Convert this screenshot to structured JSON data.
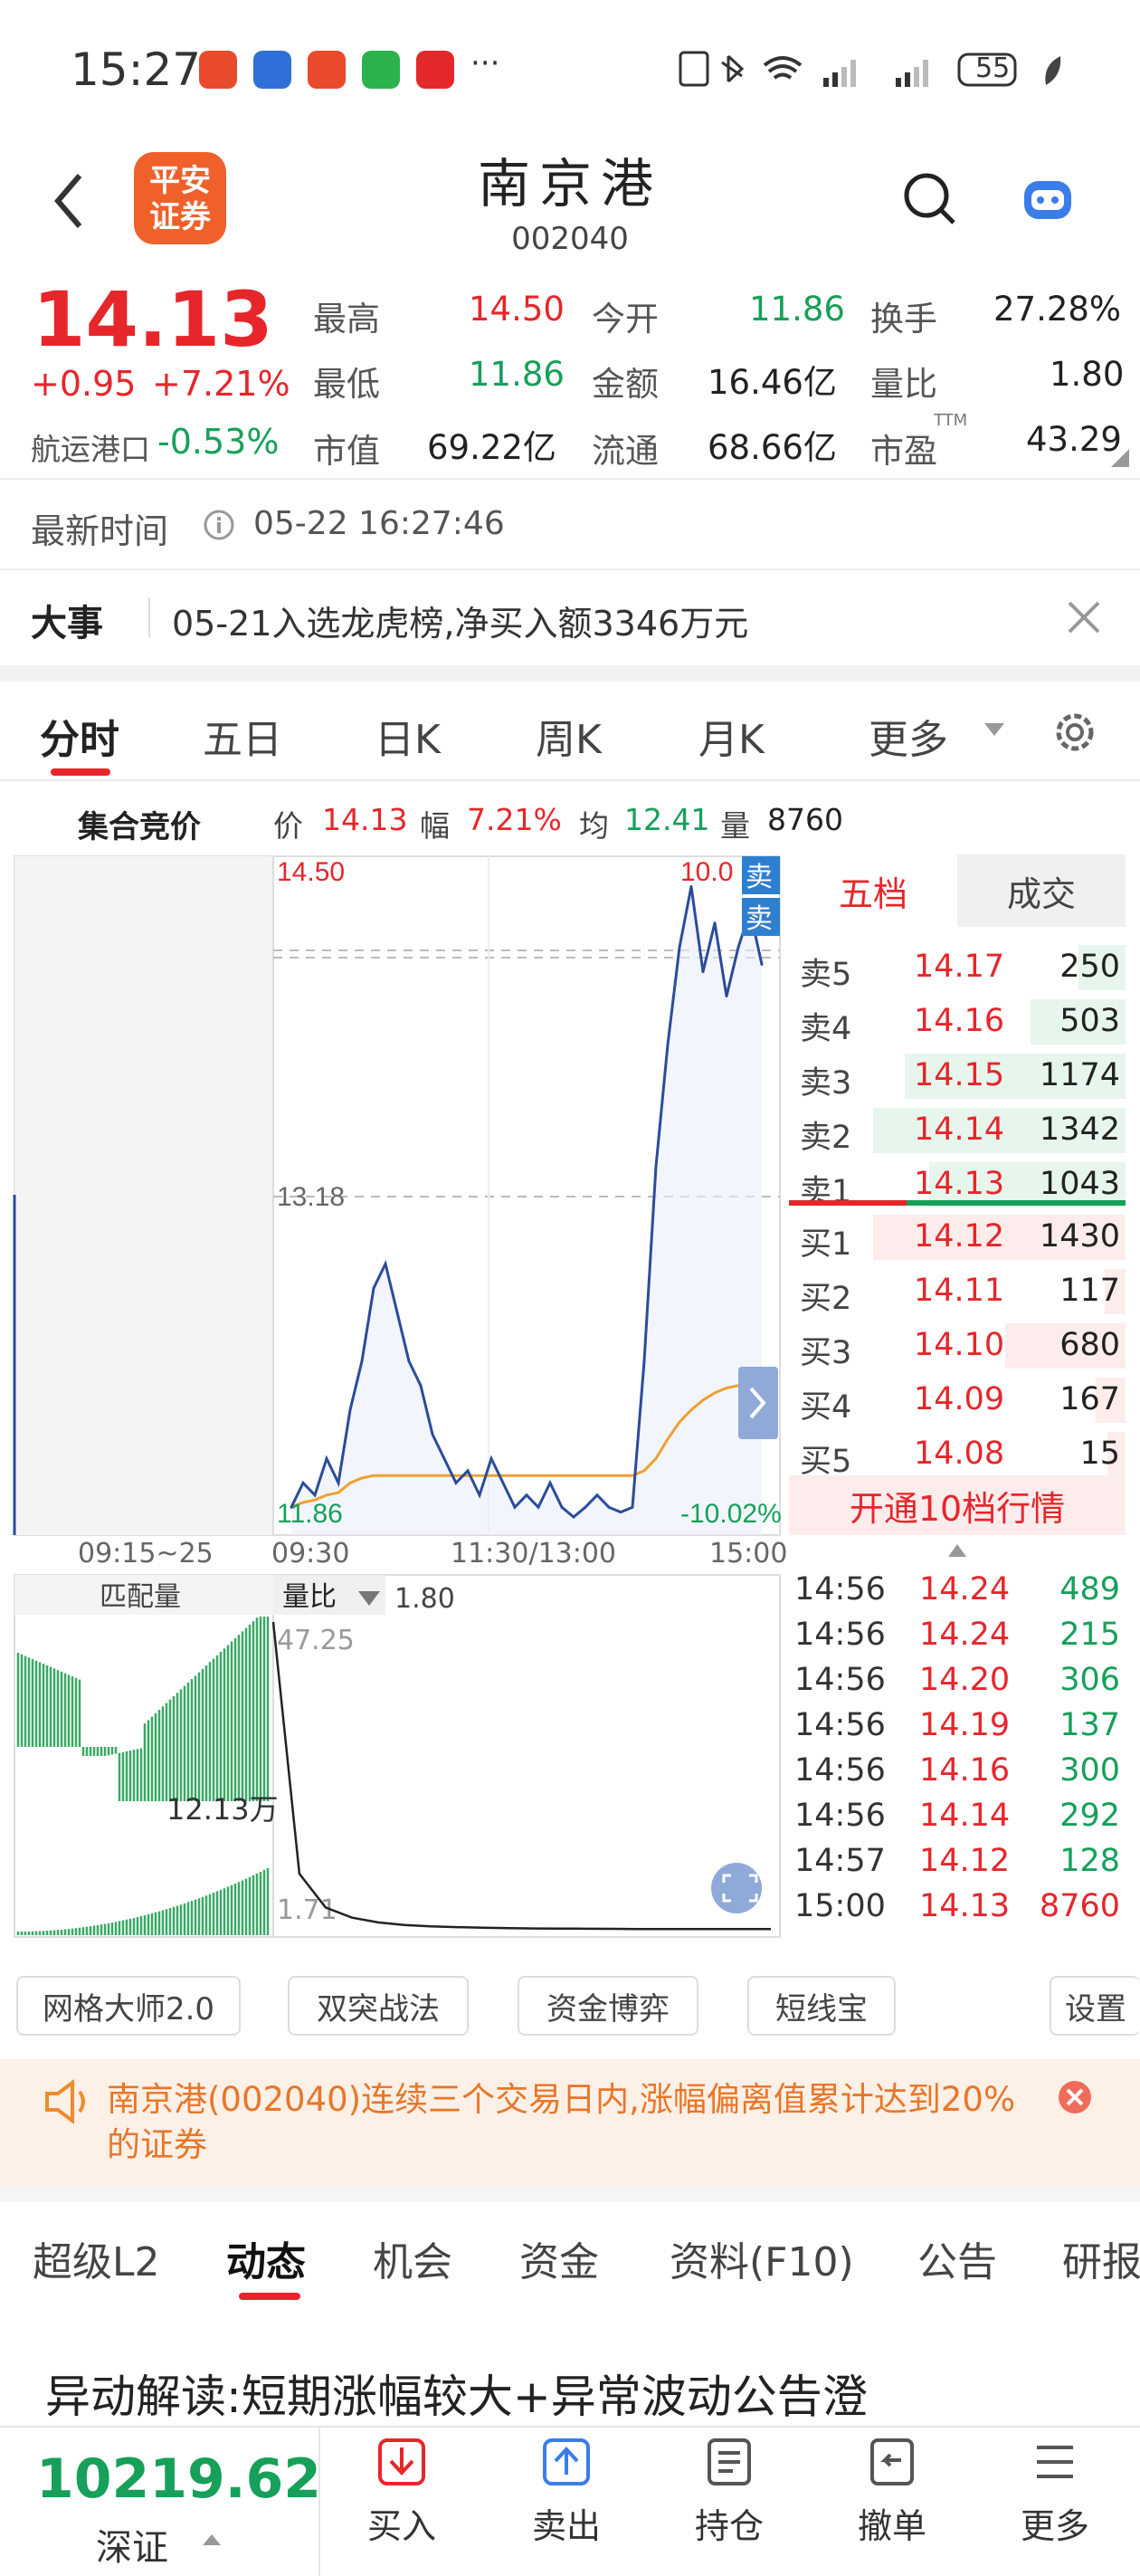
{
  "status": {
    "time": "15:27",
    "more": "···",
    "battery": "55"
  },
  "header": {
    "logo_line1": "平安",
    "logo_line2": "证券",
    "name": "南京港",
    "code": "002040"
  },
  "quote": {
    "price": "14.13",
    "change": "+0.95",
    "change_pct": "+7.21%",
    "sector_name": "航运港口",
    "sector_pct": "-0.53%",
    "high_label": "最高",
    "high": "14.50",
    "open_label": "今开",
    "open": "11.86",
    "turnover_label": "换手",
    "turnover": "27.28%",
    "low_label": "最低",
    "low": "11.86",
    "amount_label": "金额",
    "amount": "16.46亿",
    "vol_ratio_label": "量比",
    "vol_ratio": "1.80",
    "mcap_label": "市值",
    "mcap": "69.22亿",
    "float_label": "流通",
    "float_cap": "68.66亿",
    "pe_label": "市盈",
    "pe_tag": "TTM",
    "pe": "43.29"
  },
  "time_bar": {
    "label": "最新时间",
    "value": "05-22 16:27:46"
  },
  "event": {
    "label": "大事",
    "text": "05-21入选龙虎榜,净买入额3346万元"
  },
  "chart_tabs": {
    "items": [
      "分时",
      "五日",
      "日K",
      "周K",
      "月K"
    ],
    "more": "更多"
  },
  "auction": {
    "label": "集合竞价",
    "price_label": "价",
    "price": "14.13",
    "pct_label": "幅",
    "pct": "7.21%",
    "avg_label": "均",
    "avg": "12.41",
    "vol_label": "量",
    "vol": "8760"
  },
  "chart_data": {
    "type": "line",
    "title": "",
    "y_ticks": [
      "14.50",
      "13.18",
      "11.86"
    ],
    "right_ticks": [
      "10.0",
      "-10.02%"
    ],
    "x_ticks": [
      "09:15~25",
      "09:30",
      "11:30/13:00",
      "15:00"
    ],
    "ylim": [
      11.86,
      14.5
    ],
    "price": [
      11.9,
      12.0,
      11.95,
      12.1,
      12.0,
      12.3,
      12.5,
      12.8,
      12.9,
      12.7,
      12.5,
      12.4,
      12.2,
      12.1,
      12.0,
      12.05,
      11.95,
      12.1,
      12.0,
      11.9,
      11.95,
      11.9,
      12.0,
      11.9,
      11.86,
      11.9,
      11.95,
      11.9,
      11.88,
      11.9,
      12.5,
      13.3,
      13.8,
      14.2,
      14.45,
      14.1,
      14.3,
      14.0,
      14.2,
      14.35,
      14.13
    ],
    "avg": [
      11.9,
      11.92,
      11.93,
      11.95,
      11.96,
      12.0,
      12.02,
      12.03,
      12.03,
      12.03,
      12.03,
      12.03,
      12.03,
      12.03,
      12.03,
      12.03,
      12.03,
      12.03,
      12.03,
      12.03,
      12.03,
      12.03,
      12.03,
      12.03,
      12.03,
      12.03,
      12.03,
      12.03,
      12.03,
      12.03,
      12.05,
      12.1,
      12.18,
      12.25,
      12.3,
      12.34,
      12.37,
      12.39,
      12.4,
      12.41,
      12.41
    ],
    "pre_match_label": "匹配量",
    "pre_match_value": "12.13万",
    "ratio_label": "量比",
    "ratio": "1.80",
    "ratio_top": "47.25",
    "ratio_bottom": "1.71",
    "ratio_series": [
      47.25,
      10,
      5,
      3.5,
      2.8,
      2.4,
      2.2,
      2.1,
      2.0,
      1.95,
      1.9,
      1.88,
      1.86,
      1.84,
      1.82,
      1.81,
      1.8,
      1.8,
      1.8,
      1.8
    ]
  },
  "orderbook": {
    "tab1": "五档",
    "tab2": "成交",
    "asks": [
      {
        "label": "卖5",
        "price": "14.17",
        "vol": "250"
      },
      {
        "label": "卖4",
        "price": "14.16",
        "vol": "503"
      },
      {
        "label": "卖3",
        "price": "14.15",
        "vol": "1174"
      },
      {
        "label": "卖2",
        "price": "14.14",
        "vol": "1342"
      },
      {
        "label": "卖1",
        "price": "14.13",
        "vol": "1043"
      }
    ],
    "bids": [
      {
        "label": "买1",
        "price": "14.12",
        "vol": "1430"
      },
      {
        "label": "买2",
        "price": "14.11",
        "vol": "117"
      },
      {
        "label": "买3",
        "price": "14.10",
        "vol": "680"
      },
      {
        "label": "买4",
        "price": "14.09",
        "vol": "167"
      },
      {
        "label": "买5",
        "price": "14.08",
        "vol": "15"
      }
    ],
    "open10": "开通10档行情",
    "sell_tag": "卖"
  },
  "trades": [
    {
      "t": "14:56",
      "p": "14.24",
      "v": "489"
    },
    {
      "t": "14:56",
      "p": "14.24",
      "v": "215"
    },
    {
      "t": "14:56",
      "p": "14.20",
      "v": "306"
    },
    {
      "t": "14:56",
      "p": "14.19",
      "v": "137"
    },
    {
      "t": "14:56",
      "p": "14.16",
      "v": "300"
    },
    {
      "t": "14:56",
      "p": "14.14",
      "v": "292"
    },
    {
      "t": "14:57",
      "p": "14.12",
      "v": "128"
    },
    {
      "t": "15:00",
      "p": "14.13",
      "v": "8760"
    }
  ],
  "tools": {
    "grid": "网格大师2.0",
    "breakout": "双突战法",
    "fund": "资金博弈",
    "short": "短线宝",
    "settings": "设置"
  },
  "notice": {
    "text": "南京港(002040)连续三个交易日内,涨幅偏离值累计达到20%的证券"
  },
  "subtabs": [
    "超级L2",
    "动态",
    "机会",
    "资金",
    "资料(F10)",
    "公告",
    "研报"
  ],
  "news": {
    "headline": "异动解读:短期涨幅较大+异常波动公告澄"
  },
  "bottom": {
    "index_value": "10219.62",
    "index_name": "深证",
    "buy": "买入",
    "sell": "卖出",
    "hold": "持仓",
    "cancel": "撤单",
    "more": "更多"
  },
  "colors": {
    "up": "#e6262b",
    "down": "#16a05a",
    "line": "#2b4c9b",
    "avg": "#f0a030"
  }
}
